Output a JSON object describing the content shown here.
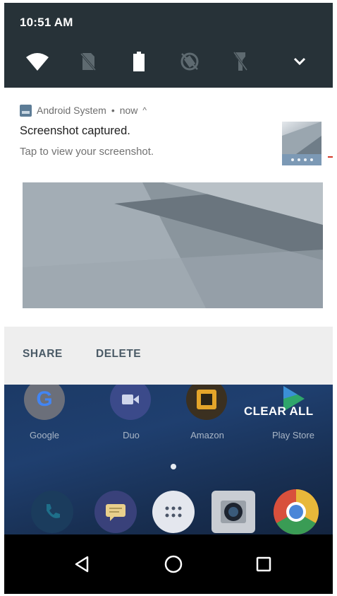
{
  "status_bar": {
    "time": "10:51 AM"
  },
  "quick_settings": {
    "tiles": [
      "wifi-icon",
      "no-sim-icon",
      "battery-icon",
      "rotation-off-icon",
      "flashlight-off-icon"
    ],
    "expand": "chevron-down-icon"
  },
  "notification": {
    "app_name": "Android System",
    "separator": " • ",
    "when": "now",
    "expand_icon": "^",
    "title": "Screenshot captured.",
    "text": "Tap to view your screenshot.",
    "actions": {
      "share": "SHARE",
      "delete": "DELETE"
    }
  },
  "home": {
    "clear_all": "CLEAR ALL",
    "apps": [
      "Google",
      "Duo",
      "Amazon",
      "Play Store"
    ]
  },
  "colors": {
    "header_bg": "#273238",
    "accent": "#4a5a66",
    "home_bg": "#1f3f6f"
  }
}
